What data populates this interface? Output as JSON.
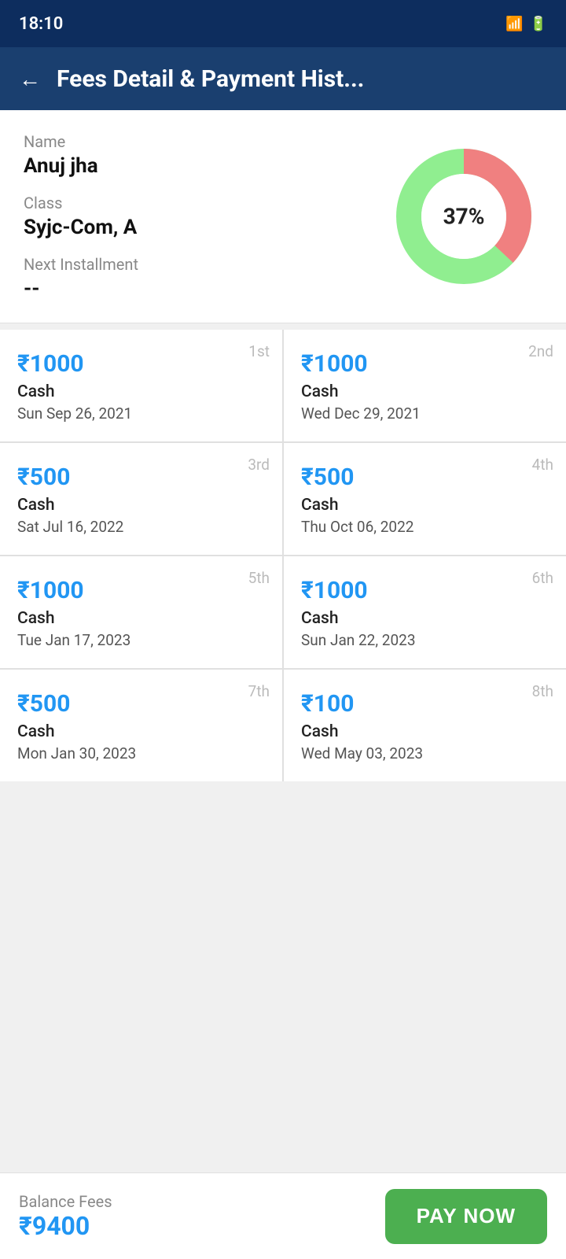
{
  "statusBar": {
    "time": "18:10",
    "icons": "♥ ◎ ➤ ∞ • ⏰ 🔕 ⇌ 📶 🔋"
  },
  "appBar": {
    "backLabel": "←",
    "title": "Fees Detail & Payment Hist..."
  },
  "studentInfo": {
    "nameLabel": "Name",
    "nameValue": "Anuj jha",
    "classLabel": "Class",
    "classValue": "Syjc-Com, A",
    "installmentLabel": "Next Installment",
    "installmentValue": "--",
    "chartPercent": "37%",
    "paidPercent": 37,
    "unpaidPercent": 63
  },
  "payments": [
    {
      "installment": "1st",
      "amount": "₹1000",
      "method": "Cash",
      "date": "Sun Sep 26, 2021"
    },
    {
      "installment": "2nd",
      "amount": "₹1000",
      "method": "Cash",
      "date": "Wed Dec 29, 2021"
    },
    {
      "installment": "3rd",
      "amount": "₹500",
      "method": "Cash",
      "date": "Sat Jul 16, 2022"
    },
    {
      "installment": "4th",
      "amount": "₹500",
      "method": "Cash",
      "date": "Thu Oct 06, 2022"
    },
    {
      "installment": "5th",
      "amount": "₹1000",
      "method": "Cash",
      "date": "Tue Jan 17, 2023"
    },
    {
      "installment": "6th",
      "amount": "₹1000",
      "method": "Cash",
      "date": "Sun Jan 22, 2023"
    },
    {
      "installment": "7th",
      "amount": "₹500",
      "method": "Cash",
      "date": "Mon Jan 30, 2023"
    },
    {
      "installment": "8th",
      "amount": "₹100",
      "method": "Cash",
      "date": "Wed May 03, 2023"
    }
  ],
  "bottomBar": {
    "balanceLabel": "Balance Fees",
    "balanceAmount": "₹9400",
    "payNowLabel": "PAY NOW"
  },
  "colors": {
    "paid": "#f08080",
    "unpaid": "#90ee90",
    "accent": "#2196F3",
    "appBar": "#1a3f6f"
  }
}
